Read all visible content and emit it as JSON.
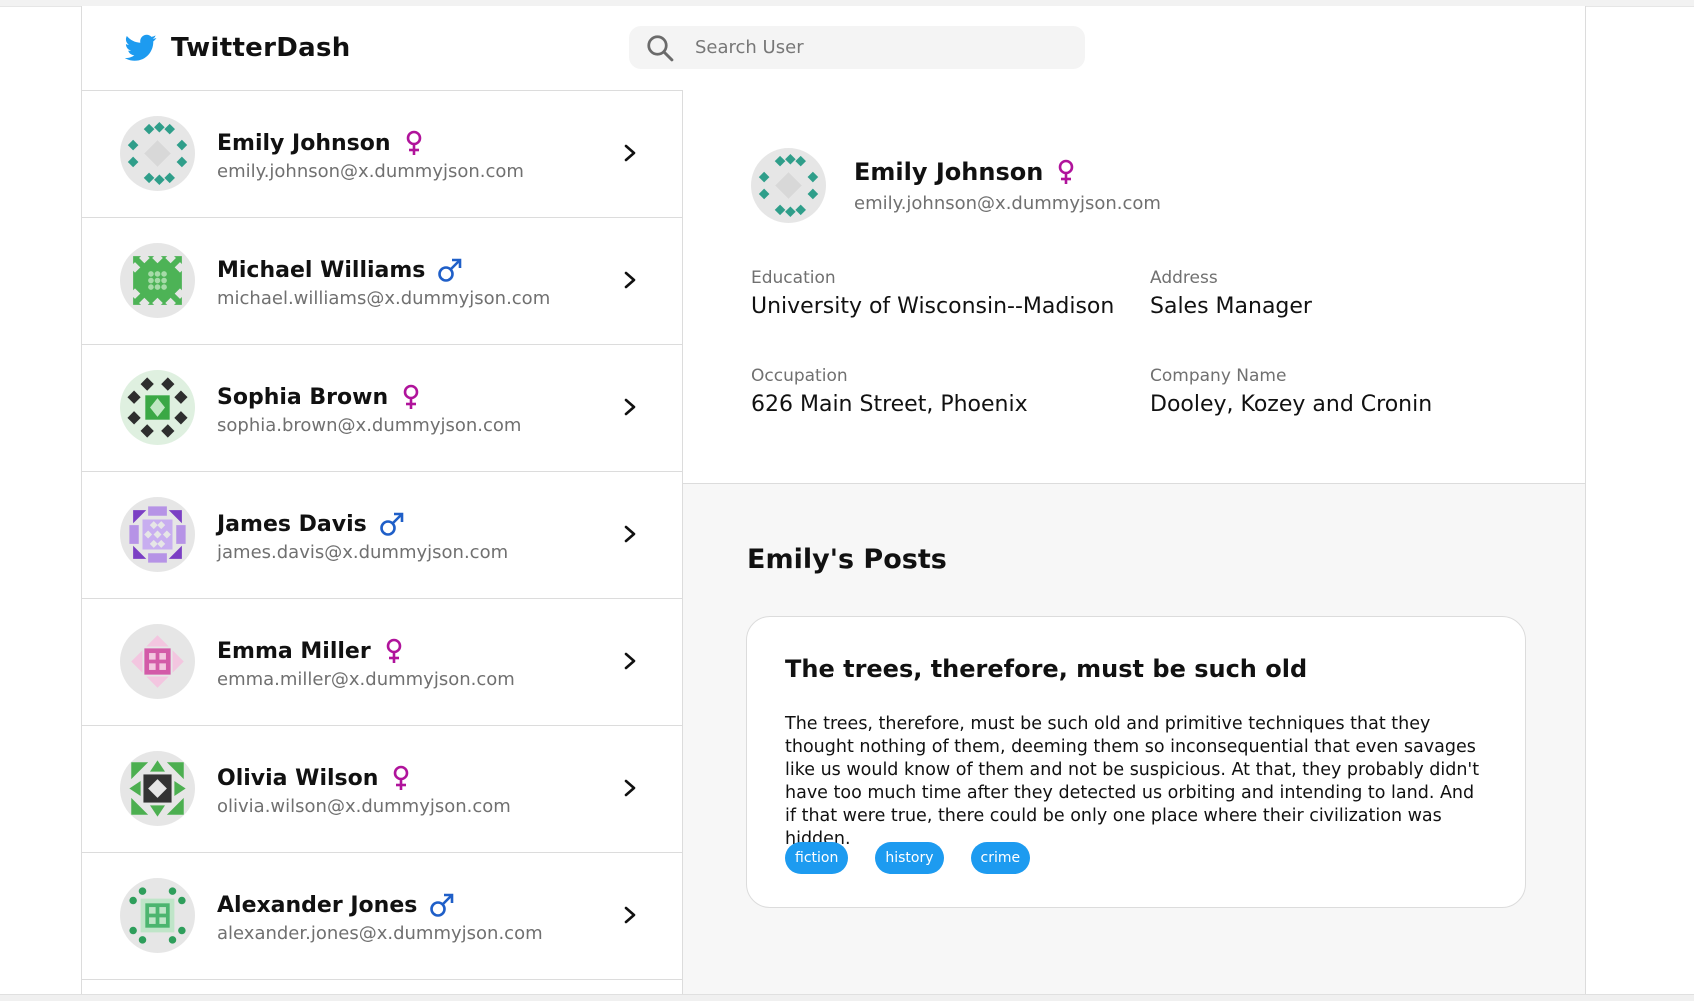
{
  "app": {
    "title": "TwitterDash"
  },
  "search": {
    "placeholder": "Search User",
    "value": ""
  },
  "users": [
    {
      "name": "Emily Johnson",
      "email": "emily.johnson@x.dummyjson.com",
      "gender": "female"
    },
    {
      "name": "Michael Williams",
      "email": "michael.williams@x.dummyjson.com",
      "gender": "male"
    },
    {
      "name": "Sophia Brown",
      "email": "sophia.brown@x.dummyjson.com",
      "gender": "female"
    },
    {
      "name": "James Davis",
      "email": "james.davis@x.dummyjson.com",
      "gender": "male"
    },
    {
      "name": "Emma Miller",
      "email": "emma.miller@x.dummyjson.com",
      "gender": "female"
    },
    {
      "name": "Olivia Wilson",
      "email": "olivia.wilson@x.dummyjson.com",
      "gender": "female"
    },
    {
      "name": "Alexander Jones",
      "email": "alexander.jones@x.dummyjson.com",
      "gender": "male"
    }
  ],
  "selected": {
    "name": "Emily Johnson",
    "email": "emily.johnson@x.dummyjson.com",
    "gender": "female",
    "fields": {
      "education_label": "Education",
      "education_value": "University of Wisconsin--Madison",
      "address_label": "Address",
      "address_value": "Sales Manager",
      "occupation_label": "Occupation",
      "occupation_value": "626 Main Street, Phoenix",
      "company_label": "Company Name",
      "company_value": "Dooley, Kozey and Cronin"
    }
  },
  "posts": {
    "heading": "Emily's Posts",
    "items": [
      {
        "title": "The trees, therefore, must be such old",
        "body": "The trees, therefore, must be such old and primitive techniques that they thought nothing of them, deeming them so inconsequential that even savages like us would know of them and not be suspicious. At that, they probably didn't have too much time after they detected us orbiting and intending to land. And if that were true, there could be only one place where their civilization was hidden.",
        "tags": [
          "fiction",
          "history",
          "crime"
        ]
      }
    ]
  },
  "colors": {
    "brand_blue": "#1d9bf0",
    "female_icon": "#b0139b",
    "male_icon": "#1f5fc8",
    "border": "#dcdcdc"
  },
  "icons": [
    "twitter-bird-icon",
    "search-icon",
    "female-gender-icon",
    "male-gender-icon",
    "chevron-right-icon",
    "identicon-avatar"
  ]
}
